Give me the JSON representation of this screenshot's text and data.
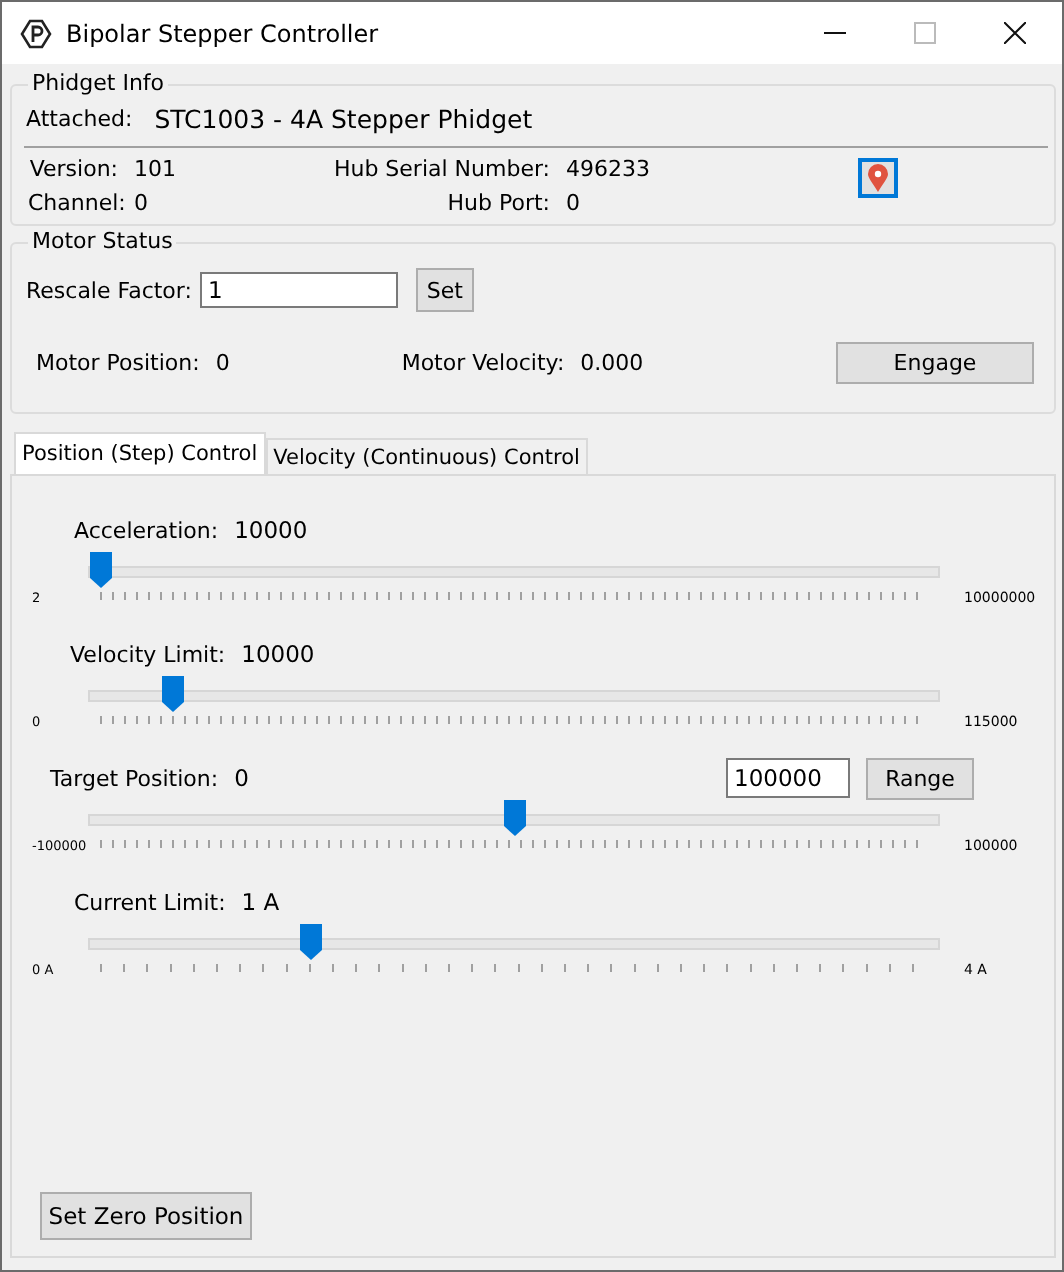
{
  "window": {
    "title": "Bipolar Stepper Controller"
  },
  "phidget_info": {
    "title": "Phidget Info",
    "attached_label": "Attached:",
    "attached_value": "STC1003 - 4A Stepper Phidget",
    "fields": [
      {
        "label": "Version:",
        "value": "101"
      },
      {
        "label": "Hub Serial Number:",
        "value": "496233"
      },
      {
        "label": "Channel:",
        "value": "0"
      },
      {
        "label": "Hub Port:",
        "value": "0"
      }
    ]
  },
  "motor_status": {
    "title": "Motor Status",
    "rescale_label": "Rescale Factor:",
    "rescale_value": "1",
    "set_button": "Set",
    "position_label": "Motor Position:",
    "position_value": "0",
    "velocity_label": "Motor Velocity:",
    "velocity_value": "0.000",
    "engage_button": "Engage"
  },
  "tabs": [
    {
      "label": "Position (Step) Control",
      "selected": true
    },
    {
      "label": "Velocity (Continuous) Control",
      "selected": false
    }
  ],
  "sliders": [
    {
      "label": "Acceleration:",
      "value": "10000",
      "min": "2",
      "max": "10000000",
      "level": 0.0
    },
    {
      "label": "Velocity Limit:",
      "value": "10000",
      "min": "0",
      "max": "115000",
      "level": 0.087
    },
    {
      "label": "Target Position:",
      "value": "0",
      "min": "-100000",
      "max": "100000",
      "level": 0.5,
      "range_value": "100000",
      "range_button": "Range"
    },
    {
      "label": "Current Limit:",
      "value": "1 A",
      "min": "0 A",
      "max": "4 A",
      "level": 0.255
    }
  ],
  "zero_button": "Set Zero Position"
}
